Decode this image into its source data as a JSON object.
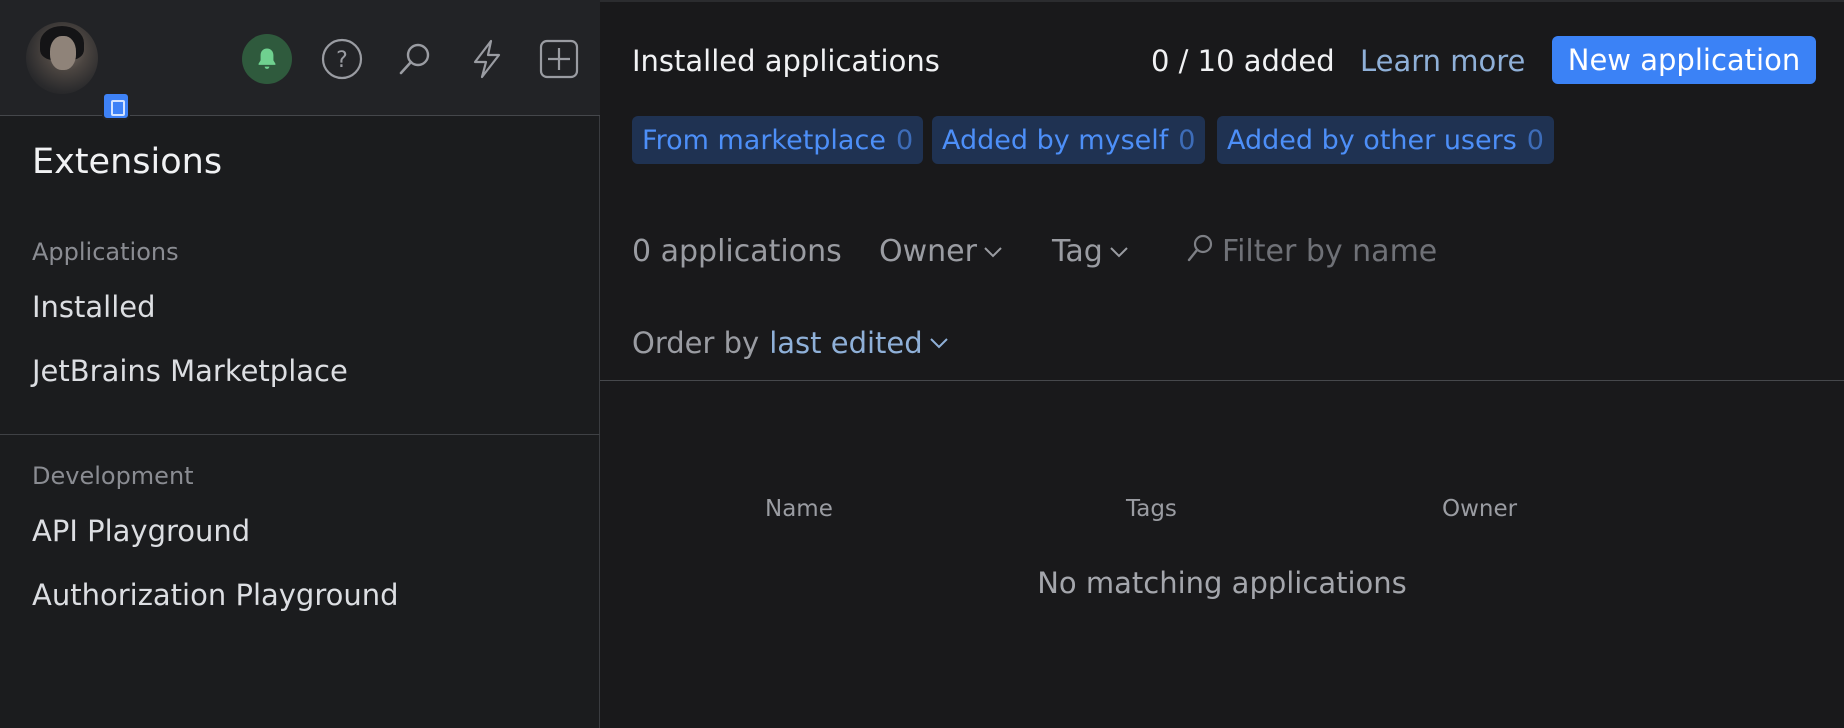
{
  "sidebar": {
    "title": "Extensions",
    "sections": [
      {
        "label": "Applications",
        "items": [
          "Installed",
          "JetBrains Marketplace"
        ]
      },
      {
        "label": "Development",
        "items": [
          "API Playground",
          "Authorization Playground"
        ]
      }
    ],
    "top_icons": [
      "bell-icon",
      "help-icon",
      "search-icon",
      "lightning-icon",
      "plus-square-icon"
    ]
  },
  "header": {
    "title": "Installed applications",
    "added_count": "0 / 10 added",
    "learn_more": "Learn more",
    "new_button": "New application"
  },
  "chips": [
    {
      "label": "From marketplace",
      "count": "0"
    },
    {
      "label": "Added by myself",
      "count": "0"
    },
    {
      "label": "Added by other users",
      "count": "0"
    }
  ],
  "filters": {
    "count_label": "0 applications",
    "owner": "Owner",
    "tag": "Tag",
    "search_placeholder": "Filter by name"
  },
  "order": {
    "label": "Order by",
    "value": "last edited"
  },
  "table": {
    "columns": [
      "Name",
      "Tags",
      "Owner"
    ],
    "empty_message": "No matching applications"
  },
  "colors": {
    "accent": "#3b82f6",
    "link": "#8fb0d8",
    "bell_bg": "#2f5a3d",
    "chip_bg": "#1f3252"
  }
}
